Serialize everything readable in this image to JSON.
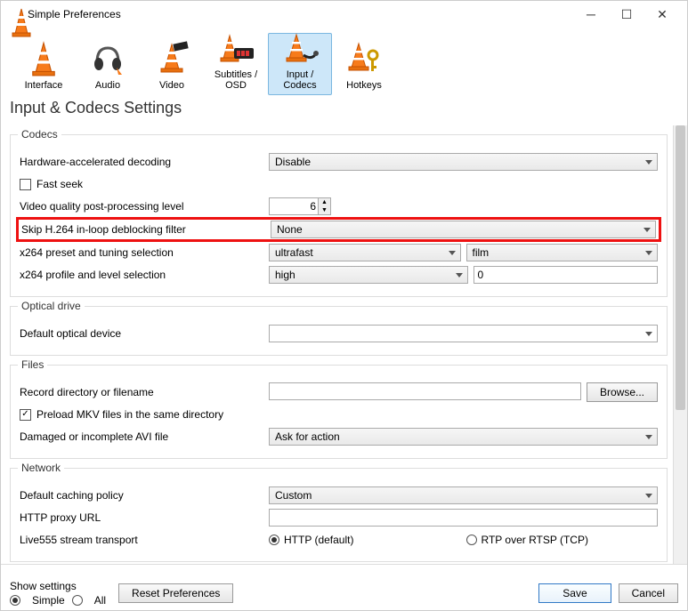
{
  "window": {
    "title": "Simple Preferences"
  },
  "tabs": {
    "interface": "Interface",
    "audio": "Audio",
    "video": "Video",
    "subtitles": "Subtitles / OSD",
    "input_codecs": "Input / Codecs",
    "hotkeys": "Hotkeys"
  },
  "heading": "Input & Codecs Settings",
  "groups": {
    "codecs": {
      "legend": "Codecs",
      "hw_decoding_label": "Hardware-accelerated decoding",
      "hw_decoding_value": "Disable",
      "fast_seek_label": "Fast seek",
      "fast_seek_checked": false,
      "post_processing_label": "Video quality post-processing level",
      "post_processing_value": "6",
      "skip_h264_label": "Skip H.264 in-loop deblocking filter",
      "skip_h264_value": "None",
      "x264_preset_label": "x264 preset and tuning selection",
      "x264_preset_value": "ultrafast",
      "x264_tune_value": "film",
      "x264_profile_label": "x264 profile and level selection",
      "x264_profile_value": "high",
      "x264_level_value": "0"
    },
    "optical": {
      "legend": "Optical drive",
      "default_device_label": "Default optical device",
      "default_device_value": ""
    },
    "files": {
      "legend": "Files",
      "record_dir_label": "Record directory or filename",
      "record_dir_value": "",
      "browse_label": "Browse...",
      "preload_mkv_label": "Preload MKV files in the same directory",
      "preload_mkv_checked": true,
      "damaged_avi_label": "Damaged or incomplete AVI file",
      "damaged_avi_value": "Ask for action"
    },
    "network": {
      "legend": "Network",
      "caching_label": "Default caching policy",
      "caching_value": "Custom",
      "http_proxy_label": "HTTP proxy URL",
      "http_proxy_value": "",
      "live555_label": "Live555 stream transport",
      "live555_http": "HTTP (default)",
      "live555_rtp": "RTP over RTSP (TCP)"
    }
  },
  "footer": {
    "show_settings_label": "Show settings",
    "simple": "Simple",
    "all": "All",
    "reset": "Reset Preferences",
    "save": "Save",
    "cancel": "Cancel"
  }
}
